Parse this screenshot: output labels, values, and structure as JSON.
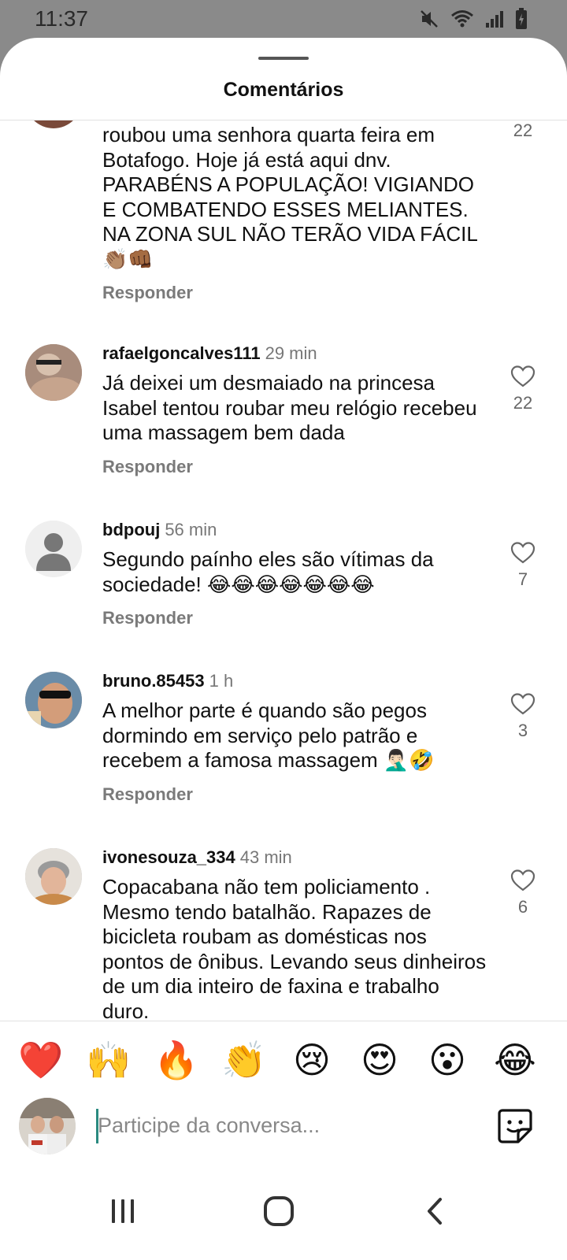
{
  "status_bar": {
    "time": "11:37"
  },
  "sheet": {
    "title": "Comentários"
  },
  "comments": [
    {
      "username": "",
      "time": "",
      "text": "roubou uma senhora quarta feira em Botafogo. Hoje já está aqui dnv. PARABÉNS A POPULAÇÃO! VIGIANDO E COMBATENDO ESSES MELIANTES.  NA ZONA SUL NÃO TERÃO VIDA FÁCIL 👏🏽👊🏾",
      "reply_label": "Responder",
      "likes": "22"
    },
    {
      "username": "rafaelgoncalves111",
      "time": "29 min",
      "text": "Já deixei um desmaiado na princesa Isabel tentou roubar meu relógio recebeu uma massagem bem dada",
      "reply_label": "Responder",
      "likes": "22"
    },
    {
      "username": "bdpouj",
      "time": "56 min",
      "text": "Segundo paínho eles são vítimas da sociedade! 😂😂😂😂😂😂😂",
      "reply_label": "Responder",
      "likes": "7"
    },
    {
      "username": "bruno.85453",
      "time": "1 h",
      "text": "A melhor parte é quando são pegos dormindo em serviço pelo patrão e recebem a famosa massagem 🤦🏻‍♂️🤣",
      "reply_label": "Responder",
      "likes": "3"
    },
    {
      "username": "ivonesouza_334",
      "time": "43 min",
      "text": "Copacabana não tem policiamento . Mesmo tendo batalhão. Rapazes de bicicleta roubam as domésticas nos pontos de ônibus.  Levando seus dinheiros de um dia inteiro  de faxina e trabalho duro.",
      "likes": "6"
    }
  ],
  "reactions": [
    "❤️",
    "🙌",
    "🔥",
    "👏",
    "😢",
    "😍",
    "😮",
    "😂"
  ],
  "composer": {
    "placeholder": "Participe da conversa..."
  },
  "icons": {
    "like": "heart-outline-icon",
    "sticker": "sticker-icon",
    "nav": [
      "recents-icon",
      "home-icon",
      "back-icon"
    ]
  },
  "colors": {
    "accent_cursor": "#2a8a80",
    "status_bar_bg": "#8a8a8a",
    "muted_text": "#7a7a7a"
  }
}
